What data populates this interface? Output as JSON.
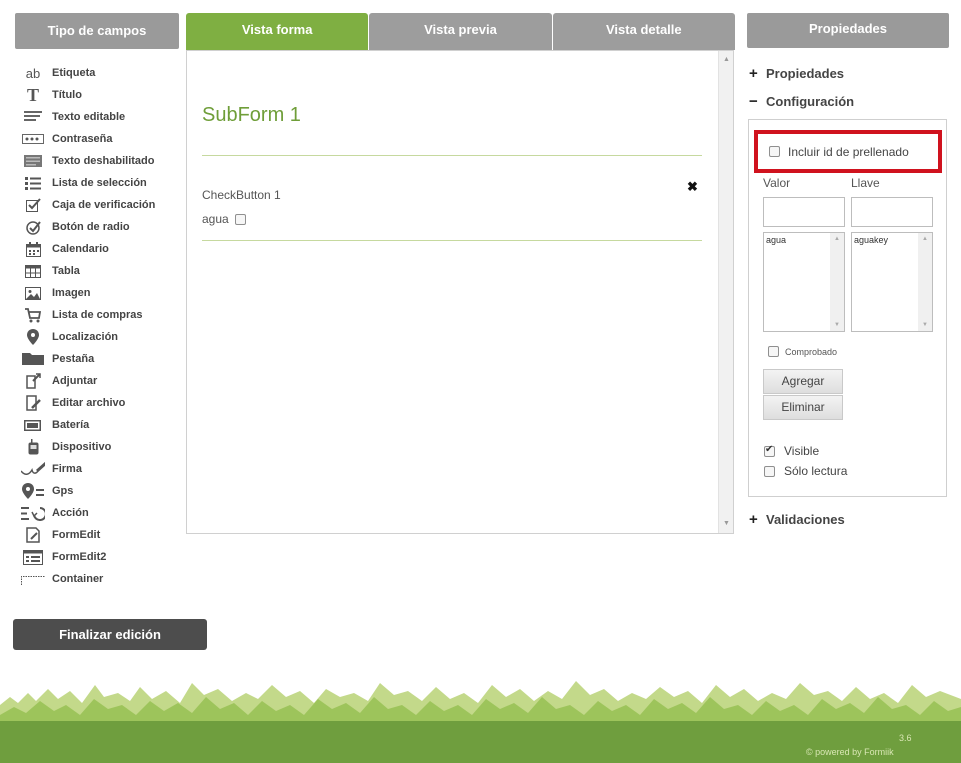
{
  "left_panel": {
    "header": "Tipo de campos",
    "items": [
      {
        "label": "Etiqueta",
        "icon": "text-ab-icon"
      },
      {
        "label": "Título",
        "icon": "title-t-icon"
      },
      {
        "label": "Texto editable",
        "icon": "editable-text-icon"
      },
      {
        "label": "Contraseña",
        "icon": "password-icon"
      },
      {
        "label": "Texto deshabilitado",
        "icon": "disabled-text-icon"
      },
      {
        "label": "Lista de selección",
        "icon": "list-icon"
      },
      {
        "label": "Caja de verificación",
        "icon": "checkbox-icon"
      },
      {
        "label": "Botón de radio",
        "icon": "radio-icon"
      },
      {
        "label": "Calendario",
        "icon": "calendar-icon"
      },
      {
        "label": "Tabla",
        "icon": "table-icon"
      },
      {
        "label": "Imagen",
        "icon": "image-icon"
      },
      {
        "label": "Lista de compras",
        "icon": "cart-icon"
      },
      {
        "label": "Localización",
        "icon": "location-pin-icon"
      },
      {
        "label": "Pestaña",
        "icon": "folder-tab-icon"
      },
      {
        "label": "Adjuntar",
        "icon": "attach-icon"
      },
      {
        "label": "Editar archivo",
        "icon": "edit-file-icon"
      },
      {
        "label": "Batería",
        "icon": "battery-icon"
      },
      {
        "label": "Dispositivo",
        "icon": "device-icon"
      },
      {
        "label": "Firma",
        "icon": "signature-icon"
      },
      {
        "label": "Gps",
        "icon": "gps-icon"
      },
      {
        "label": "Acción",
        "icon": "action-icon"
      },
      {
        "label": "FormEdit",
        "icon": "formedit-icon"
      },
      {
        "label": "FormEdit2",
        "icon": "formedit2-icon"
      },
      {
        "label": "Container",
        "icon": "container-icon"
      }
    ],
    "finish_button": "Finalizar edición"
  },
  "tabs": [
    {
      "label": "Vista forma",
      "active": true
    },
    {
      "label": "Vista previa",
      "active": false
    },
    {
      "label": "Vista detalle",
      "active": false
    }
  ],
  "form": {
    "subform_title": "SubForm 1",
    "checkbutton_title": "CheckButton 1",
    "checkbox_label": "agua",
    "close_glyph": "✖"
  },
  "right_panel": {
    "header": "Propiedades",
    "sections": {
      "propiedades": {
        "sign": "+",
        "label": "Propiedades"
      },
      "configuracion": {
        "sign": "−",
        "label": "Configuración"
      },
      "validaciones": {
        "sign": "+",
        "label": "Validaciones"
      }
    },
    "prefill_label": "Incluir id de prellenado",
    "valor_label": "Valor",
    "llave_label": "Llave",
    "valor_list": [
      "agua"
    ],
    "llave_list": [
      "aguakey"
    ],
    "comprobado_label": "Comprobado",
    "add_button": "Agregar",
    "delete_button": "Eliminar",
    "visible_label": "Visible",
    "visible_checked": true,
    "readonly_label": "Sólo lectura",
    "readonly_checked": false
  },
  "footer": {
    "version": "3.6",
    "powered": "© powered by Formiik"
  },
  "colors": {
    "accent_green": "#7faf42",
    "header_gray": "#9a9a9a",
    "highlight_red": "#d0121e",
    "dark_button": "#4d4d4d"
  }
}
